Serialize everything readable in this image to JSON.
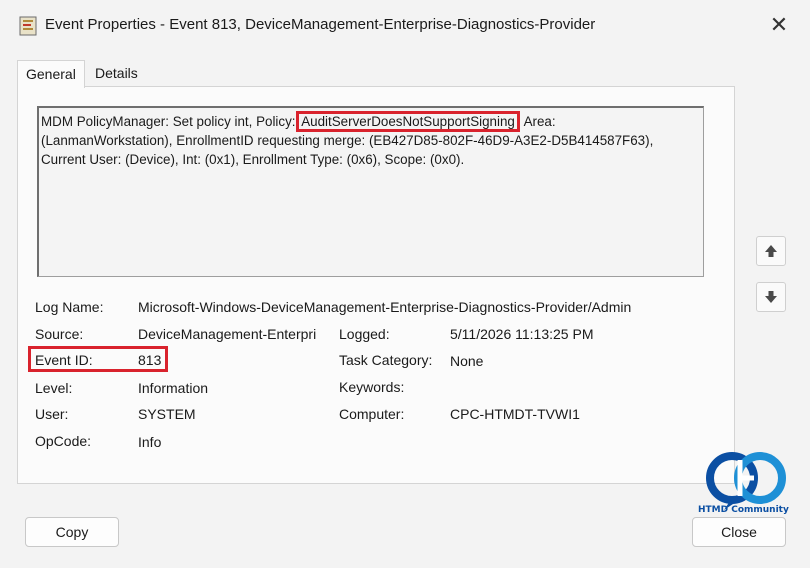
{
  "window": {
    "title": "Event Properties - Event 813, DeviceManagement-Enterprise-Diagnostics-Provider",
    "close_glyph": "✕"
  },
  "tabs": [
    {
      "label": "General",
      "active": true
    },
    {
      "label": "Details",
      "active": false
    }
  ],
  "description": {
    "before": "MDM PolicyManager: Set policy int, Policy: ",
    "highlight": "AuditServerDoesNotSupportSigning",
    "after": ", Area: (LanmanWorkstation), EnrollmentID requesting merge: (EB427D85-802F-46D9-A3E2-D5B414587F63), Current User: (Device), Int: (0x1), Enrollment Type: (0x6), Scope: (0x0)."
  },
  "fields": {
    "log_name_label": "Log Name:",
    "log_name_value": "Microsoft-Windows-DeviceManagement-Enterprise-Diagnostics-Provider/Admin",
    "source_label": "Source:",
    "source_value": "DeviceManagement-Enterpri",
    "logged_label": "Logged:",
    "logged_value": "5/11/2026 11:13:25 PM",
    "event_id_label": "Event ID:",
    "event_id_value": "813",
    "task_category_label": "Task Category:",
    "task_category_value": "None",
    "level_label": "Level:",
    "level_value": "Information",
    "keywords_label": "Keywords:",
    "keywords_value": "",
    "user_label": "User:",
    "user_value": "SYSTEM",
    "computer_label": "Computer:",
    "computer_value": "CPC-HTMDT-TVWI1",
    "opcode_label": "OpCode:",
    "opcode_value": "Info"
  },
  "buttons": {
    "copy": "Copy",
    "close": "Close"
  },
  "icons": {
    "up": "arrow-up-icon",
    "down": "arrow-down-icon",
    "app": "event-viewer-icon"
  },
  "logo": {
    "text": "HTMD Community"
  },
  "colors": {
    "highlight": "#d9232d",
    "logo_blue": "#0b4fa3"
  }
}
